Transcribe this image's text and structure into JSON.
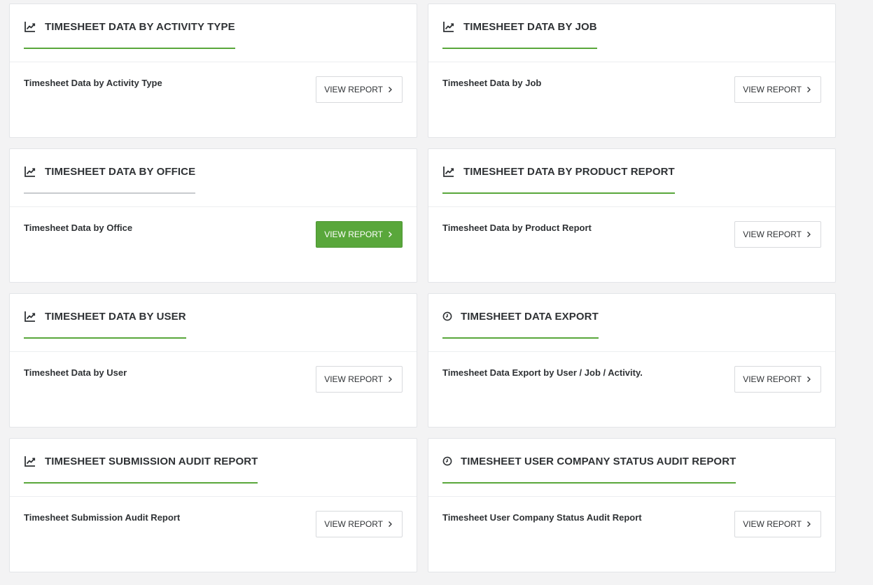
{
  "colors": {
    "accent": "#59a73b",
    "underline_inactive": "#c8cbce"
  },
  "cards": [
    {
      "title": "TIMESHEET DATA BY ACTIVITY TYPE",
      "icon": "line-chart-icon",
      "description": "Timesheet Data by Activity Type",
      "button_label": "VIEW REPORT"
    },
    {
      "title": "TIMESHEET DATA BY JOB",
      "icon": "line-chart-icon",
      "description": "Timesheet Data by Job",
      "button_label": "VIEW REPORT"
    },
    {
      "title": "TIMESHEET DATA BY OFFICE",
      "icon": "line-chart-icon",
      "description": "Timesheet Data by Office",
      "button_label": "VIEW REPORT",
      "button_state": "hovered"
    },
    {
      "title": "TIMESHEET DATA BY PRODUCT REPORT",
      "icon": "line-chart-icon",
      "description": "Timesheet Data by Product Report",
      "button_label": "VIEW REPORT"
    },
    {
      "title": "TIMESHEET DATA BY USER",
      "icon": "line-chart-icon",
      "description": "Timesheet Data by User",
      "button_label": "VIEW REPORT"
    },
    {
      "title": "TIMESHEET DATA EXPORT",
      "icon": "clock-icon",
      "description": "Timesheet Data Export by User / Job / Activity.",
      "button_label": "VIEW REPORT"
    },
    {
      "title": "TIMESHEET SUBMISSION AUDIT REPORT",
      "icon": "line-chart-icon",
      "description": "Timesheet Submission Audit Report",
      "button_label": "VIEW REPORT"
    },
    {
      "title": "TIMESHEET USER COMPANY STATUS AUDIT REPORT",
      "icon": "clock-icon",
      "description": "Timesheet User Company Status Audit Report",
      "button_label": "VIEW REPORT"
    }
  ]
}
